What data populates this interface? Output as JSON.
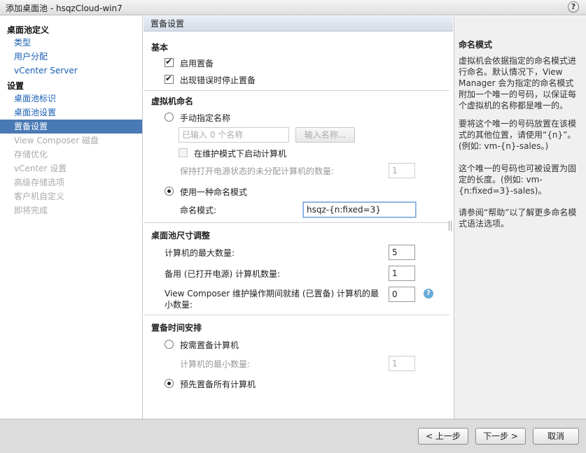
{
  "window": {
    "title": "添加桌面池 - hsqzCloud-win7",
    "help_label": "?"
  },
  "sidebar": {
    "group1": "桌面池定义",
    "group2": "设置",
    "items": [
      {
        "label": "类型"
      },
      {
        "label": "用户分配"
      },
      {
        "label": "vCenter Server"
      },
      {
        "label": "桌面池标识"
      },
      {
        "label": "桌面池设置"
      },
      {
        "label": "置备设置"
      },
      {
        "label": "View Composer 磁盘"
      },
      {
        "label": "存储优化"
      },
      {
        "label": "vCenter 设置"
      },
      {
        "label": "高级存储选项"
      },
      {
        "label": "客户机自定义"
      },
      {
        "label": "即将完成"
      }
    ]
  },
  "main": {
    "header": "置备设置",
    "basic": {
      "title": "基本",
      "enable_provisioning": "启用置备",
      "stop_on_error": "出现错误时停止置备"
    },
    "naming": {
      "title": "虚拟机命名",
      "manual_label": "手动指定名称",
      "manual_input_placeholder": "已输入 0 个名称",
      "enter_names_button": "输入名称...",
      "maintenance_label": "在维护模式下启动计算机",
      "unassigned_label": "保持打开电源状态的未分配计算机的数量:",
      "unassigned_value": "1",
      "pattern_label": "使用一种命名模式",
      "pattern_field_label": "命名模式:",
      "pattern_value": "hsqz-{n:fixed=3}"
    },
    "sizing": {
      "title": "桌面池尺寸调整",
      "max_label": "计算机的最大数量:",
      "max_value": "5",
      "spare_label": "备用 (已打开电源) 计算机数量:",
      "spare_value": "1",
      "min_ready_label": "View Composer 维护操作期间就绪 (已置备) 计算机的最小数量:",
      "min_ready_value": "0"
    },
    "timing": {
      "title": "置备时间安排",
      "on_demand_label": "按需置备计算机",
      "min_label": "计算机的最小数量:",
      "min_value": "1",
      "upfront_label": "预先置备所有计算机"
    }
  },
  "help": {
    "title": "命名模式",
    "p1": "虚拟机会依据指定的命名模式进行命名。默认情况下，View Manager 会为指定的命名模式附加一个唯一的号码，以保证每个虚拟机的名称都是唯一的。",
    "p2": "要将这个唯一的号码放置在该模式的其他位置，请使用“{n}”。(例如: vm-{n}-sales。)",
    "p3": "这个唯一的号码也可被设置为固定的长度。(例如: vm-{n:fixed=3}-sales)。",
    "p4": "请参阅“帮助”以了解更多命名模式语法选项。"
  },
  "footer": {
    "back": "< 上一步",
    "next": "下一步 >",
    "cancel": "取消"
  }
}
